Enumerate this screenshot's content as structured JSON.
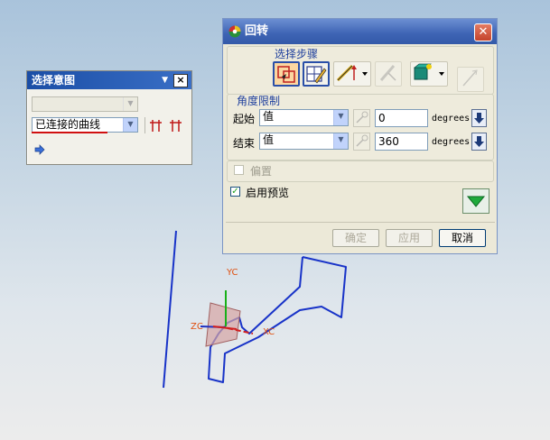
{
  "selection_intent": {
    "title": "选择意图",
    "top_combo_value": "",
    "curve_rule_value": "已连接的曲线",
    "close": "×"
  },
  "revolve_dialog": {
    "title": "回转",
    "close": "✕",
    "selection_steps_label": "选择步骤",
    "angle_limits_label": "角度限制",
    "start": {
      "label": "起始",
      "type": "值",
      "value": "0",
      "unit": "degrees"
    },
    "end": {
      "label": "结束",
      "type": "值",
      "value": "360",
      "unit": "degrees"
    },
    "offset_label": "偏置",
    "offset_checked": false,
    "preview_label": "启用预览",
    "preview_checked": true,
    "buttons": {
      "ok": "确定",
      "apply": "应用",
      "cancel": "取消"
    }
  },
  "scene": {
    "axis_labels": {
      "yc": "YC",
      "zc": "ZC",
      "xc": "XC"
    }
  },
  "colors": {
    "curve": "#1833c8",
    "axis_label": "#e05010",
    "dialog_title": "#3d63b4"
  }
}
